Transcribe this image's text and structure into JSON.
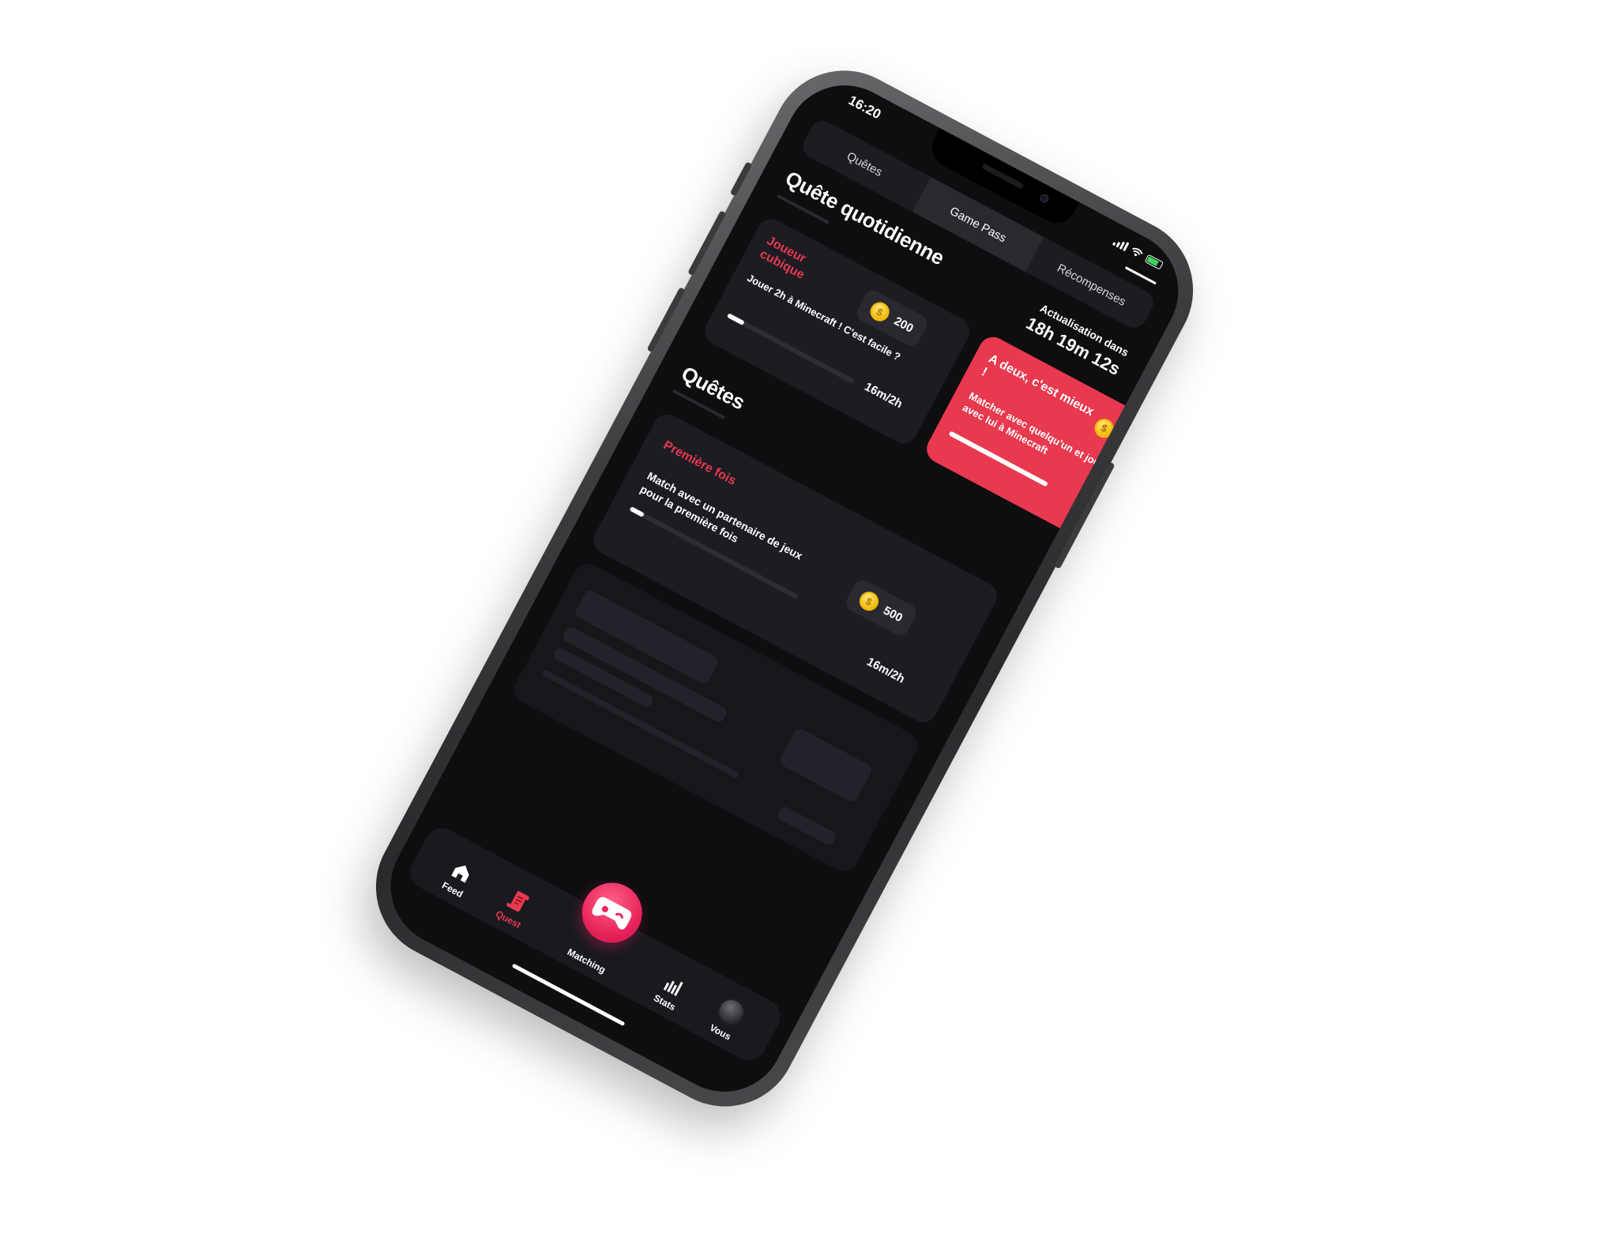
{
  "status_bar": {
    "time": "16:20"
  },
  "tabs": [
    {
      "label": "Quêtes"
    },
    {
      "label": "Game Pass"
    },
    {
      "label": "Récompenses"
    }
  ],
  "daily": {
    "title": "Quête quotidienne",
    "refresh_label": "Actualisation dans",
    "refresh_timer": "18h 19m 12s",
    "cards": [
      {
        "title": "Joueur cubique",
        "description": "Jouer 2h à Minecraft ! C'est facile ?",
        "reward": "200",
        "progress": "16m/2h",
        "progress_fraction": 0.13
      },
      {
        "title": "A deux, c'est mieux !",
        "description": "Matcher avec quelqu'un et jouer avec lui à Minecraft"
      }
    ]
  },
  "quests": {
    "title": "Quêtes",
    "cards": [
      {
        "title": "Première fois",
        "description": "Match avec un partenaire de jeux pour la première fois",
        "reward": "500",
        "progress": "16m/2h",
        "progress_fraction": 0.08
      }
    ]
  },
  "bottom_nav": {
    "items": [
      {
        "label": "Feed",
        "icon": "home-icon"
      },
      {
        "label": "Quest",
        "icon": "scroll-icon"
      },
      {
        "label": "Matching",
        "icon": "gamepad-icon"
      },
      {
        "label": "Stats",
        "icon": "bar-chart-icon"
      },
      {
        "label": "Vous",
        "icon": "avatar-icon"
      }
    ],
    "active": "Quest"
  },
  "colors": {
    "accent": "#e8394f",
    "background": "#0e0d10",
    "card": "#1d1c22",
    "coin": "#f4c21a"
  }
}
